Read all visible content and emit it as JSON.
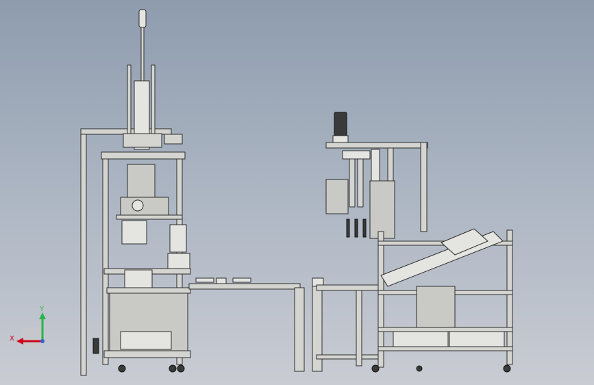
{
  "view": {
    "background_top": "#8e9cae",
    "background_bottom": "#c9ccd3"
  },
  "triad": {
    "x_label": "X",
    "y_label": "Y",
    "x_color": "#d0021b",
    "y_color": "#2bb34a",
    "z_color": "#3a5fcd"
  }
}
